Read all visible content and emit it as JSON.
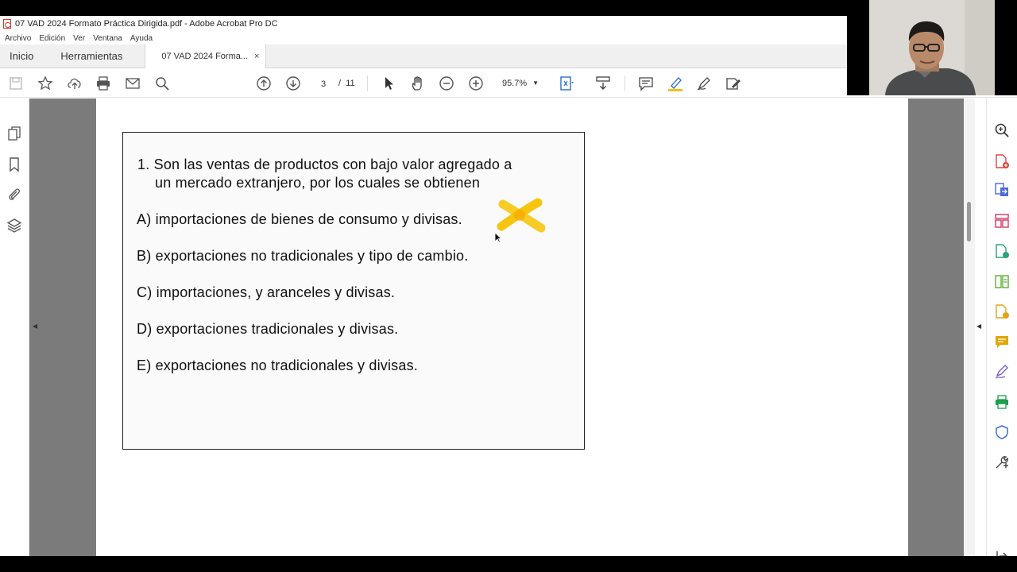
{
  "window": {
    "title": "07 VAD 2024 Formato Práctica Dirigida.pdf - Adobe Acrobat Pro DC"
  },
  "menu": [
    "Archivo",
    "Edición",
    "Ver",
    "Ventana",
    "Ayuda"
  ],
  "tabs": {
    "home": "Inicio",
    "tools": "Herramientas",
    "document": "07 VAD 2024 Forma...",
    "close": "×"
  },
  "toolbar": {
    "current_page": "3",
    "page_separator": "/",
    "total_pages": "11",
    "zoom": "95.7%"
  },
  "document": {
    "question": {
      "line1": "1. Son las ventas de productos con bajo valor agregado a",
      "line2": "un mercado extranjero, por los cuales se obtienen"
    },
    "options": [
      "A) importaciones de bienes de consumo y divisas.",
      "B) exportaciones no tradicionales y tipo de cambio.",
      "C) importaciones, y aranceles y divisas.",
      "D) exportaciones tradicionales y divisas.",
      "E) exportaciones no tradicionales y divisas."
    ],
    "annotation_color": "#f7c200"
  },
  "colors": {
    "doc_background": "#7b7b7b",
    "highlight_tool": "#f2c200",
    "right_rail_icons": [
      "#e0453b",
      "#4a6cd6",
      "#d6365f",
      "#2aa37a",
      "#5bb036",
      "#e3a21a",
      "#e0a800",
      "#7a5cd1",
      "#1a9e4e",
      "#3b6fd6",
      "#444444"
    ]
  }
}
